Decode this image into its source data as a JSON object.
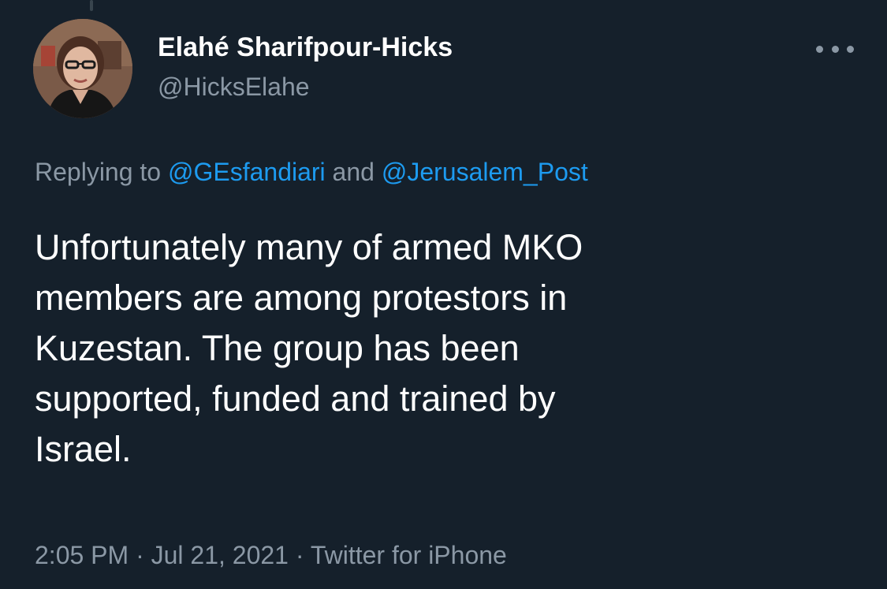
{
  "colors": {
    "background": "#15202b",
    "text_primary": "#ffffff",
    "text_secondary": "#8b98a5",
    "link": "#1d9bf0"
  },
  "tweet": {
    "author": {
      "display_name": "Elahé Sharifpour-Hicks",
      "handle": "@HicksElahe"
    },
    "reply": {
      "prefix": "Replying to ",
      "mention_1": "@GEsfandiari",
      "conjunction": " and ",
      "mention_2": "@Jerusalem_Post"
    },
    "text": "Unfortunately many of armed MKO\nmembers are among protestors in\nKuzestan. The group has been\nsupported, funded and trained by\nIsrael.",
    "meta": {
      "time": "2:05 PM",
      "separator": " · ",
      "date": "Jul 21, 2021",
      "source": "Twitter for iPhone"
    },
    "icons": {
      "more": "more-horizontal-icon"
    }
  }
}
